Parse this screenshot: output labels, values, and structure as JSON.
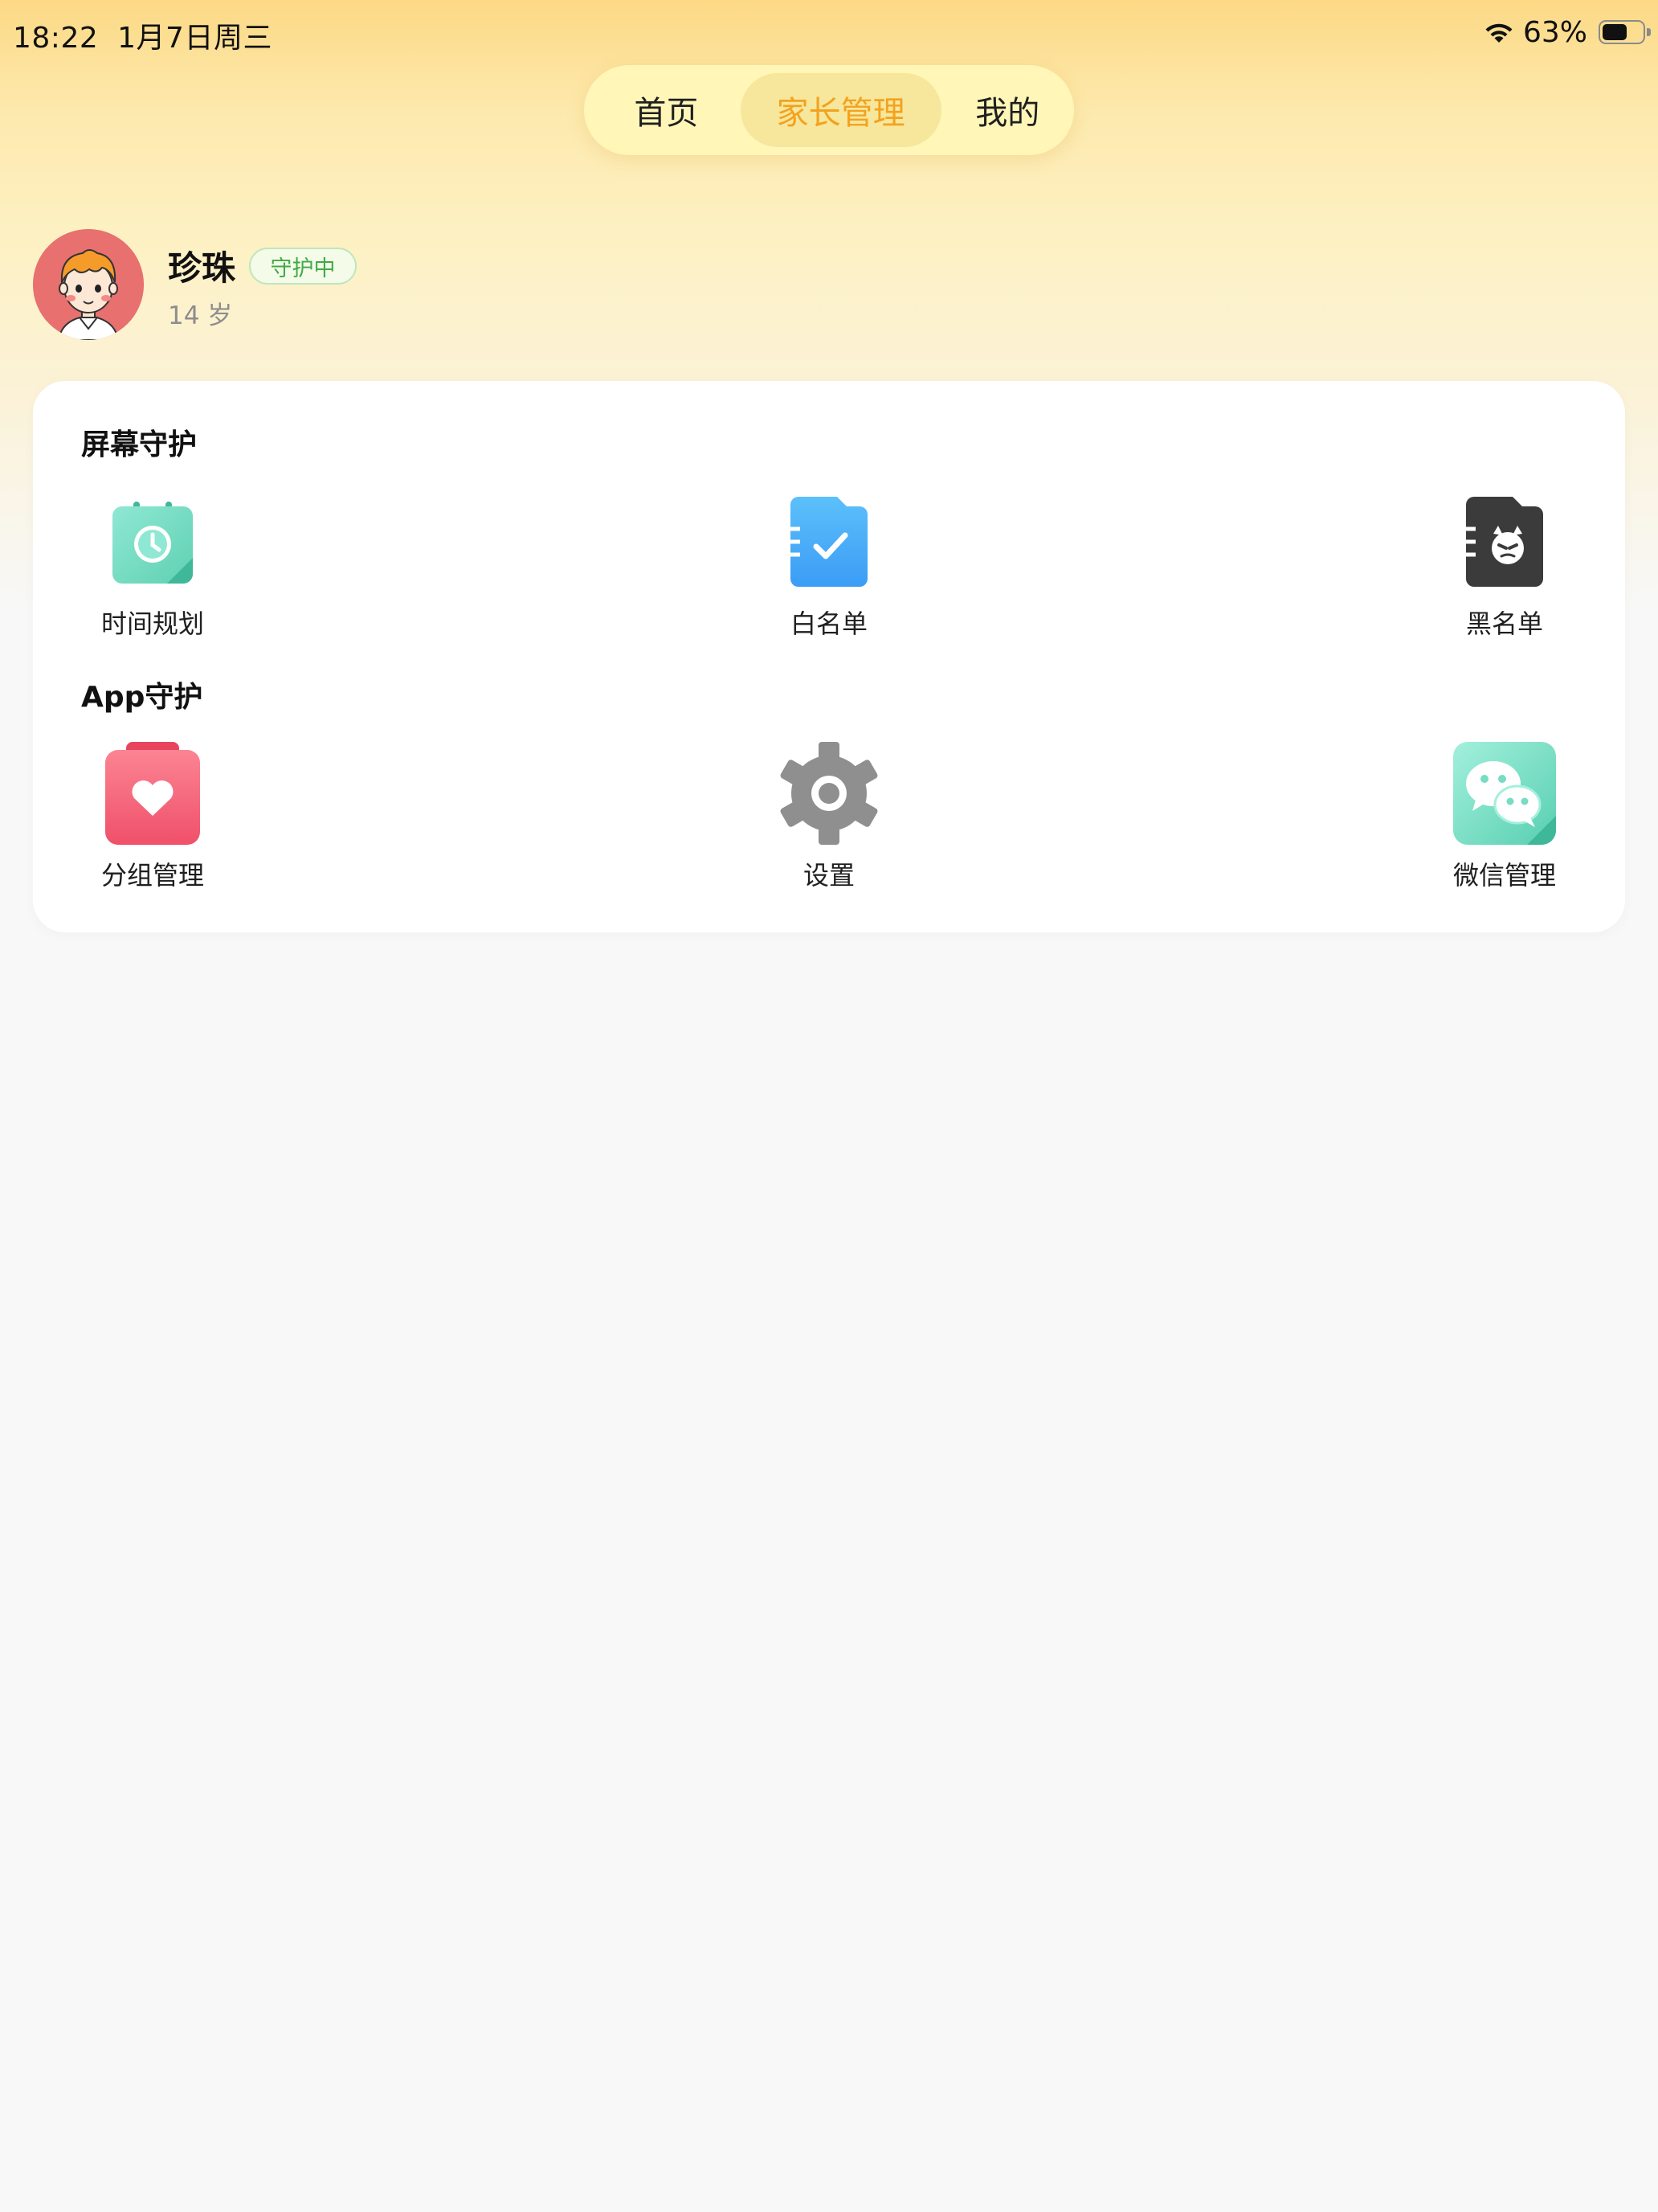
{
  "status_bar": {
    "time": "18:22",
    "date": "1月7日周三",
    "battery_percent": "63%",
    "battery_level": 0.63
  },
  "tabs": [
    {
      "label": "首页",
      "active": false
    },
    {
      "label": "家长管理",
      "active": true
    },
    {
      "label": "我的",
      "active": false
    }
  ],
  "profile": {
    "name": "珍珠",
    "status": "守护中",
    "age": "14 岁"
  },
  "sections": {
    "screen_guard": {
      "title": "屏幕守护",
      "items": [
        {
          "label": "时间规划",
          "icon": "calendar-clock-icon"
        },
        {
          "label": "白名单",
          "icon": "whitelist-folder-icon"
        },
        {
          "label": "黑名单",
          "icon": "blacklist-devil-icon"
        }
      ]
    },
    "app_guard": {
      "title": "App守护",
      "items": [
        {
          "label": "分组管理",
          "icon": "heart-bag-icon"
        },
        {
          "label": "设置",
          "icon": "gear-icon"
        },
        {
          "label": "微信管理",
          "icon": "wechat-icon"
        }
      ]
    }
  },
  "colors": {
    "accent": "#f4a21e",
    "active_tab_bg": "#f6e79c",
    "badge_green": "#3faa47"
  }
}
